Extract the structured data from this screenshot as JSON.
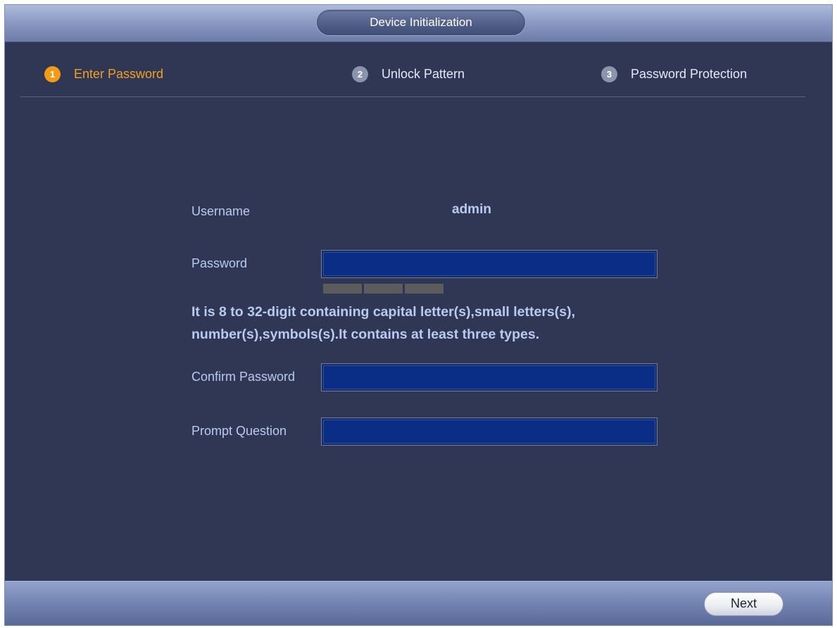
{
  "window": {
    "title": "Device Initialization"
  },
  "steps": [
    {
      "number": "1",
      "label": "Enter Password",
      "active": true
    },
    {
      "number": "2",
      "label": "Unlock Pattern",
      "active": false
    },
    {
      "number": "3",
      "label": "Password Protection",
      "active": false
    }
  ],
  "form": {
    "username_label": "Username",
    "username_value": "admin",
    "password_label": "Password",
    "password_value": "",
    "password_strength_segments": 3,
    "password_hint": "It is 8 to 32-digit containing  capital letter(s),small letters(s), number(s),symbols(s).It contains at least three types.",
    "confirm_password_label": "Confirm Password",
    "confirm_password_value": "",
    "prompt_question_label": "Prompt Question",
    "prompt_question_value": ""
  },
  "footer": {
    "next_label": "Next"
  },
  "colors": {
    "active_step": "#f29b18",
    "inactive_step": "#8a94ab",
    "background": "#2f3755",
    "field_fill": "#0a2e86",
    "label_text": "#b9caef"
  }
}
